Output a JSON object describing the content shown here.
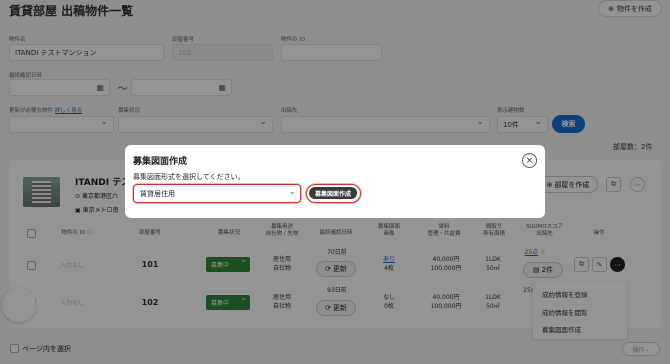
{
  "page": {
    "title": "賃貸部屋 出稿物件一覧",
    "add_button": "物件を作成"
  },
  "filters": {
    "property_name_label": "物件名",
    "property_name_value": "ITANDI テストマンション",
    "room_number_label": "部屋番号",
    "room_number_value": "102",
    "property_id_label": "物件の ID",
    "last_checked_label": "最終確認日時",
    "date_separator": "〜",
    "update_needed_label": "更新が必要な物件",
    "details_link": "詳しく見る",
    "recruitment_status_label": "募集状況",
    "listing_destination_label": "出稿先",
    "display_count_label": "表示建物数",
    "display_count_value": "10件",
    "search_button": "検索",
    "room_count": "部屋数：2件"
  },
  "building": {
    "name": "ITANDI テスト",
    "address": "東京都港区六",
    "station": "東京メトロ南",
    "create_room_button": "部屋を作成"
  },
  "table": {
    "headers": {
      "property_id": "物件の ID",
      "room_number": "部屋番号",
      "recruitment_status": "募集状況",
      "usage_line1": "募集用途",
      "usage_line2": "自社物 / 先物",
      "last_checked": "最終確認日時",
      "floorplan_line1": "募集図面",
      "floorplan_line2": "画像",
      "rent_line1": "賃料",
      "rent_line2": "管理・共益費",
      "layout_line1": "間取り",
      "layout_line2": "専有面積",
      "suumo_line1": "SUUMOスコア",
      "suumo_line2": "出稿先",
      "actions": "操作"
    },
    "rows": [
      {
        "id_placeholder": "入力なし",
        "room": "101",
        "status": "募集中",
        "usage1": "居住用",
        "usage2": "自社物",
        "days_ago": "70日前",
        "refresh": "更新",
        "floorplan1": "あり",
        "floorplan2": "4枚",
        "rent": "40,000円",
        "fee": "100,000円",
        "layout": "1LDK",
        "area": "50㎡",
        "score": "25点",
        "score_warn": "⚠",
        "media_count": "2件"
      },
      {
        "id_placeholder": "入力なし",
        "room": "102",
        "status": "募集中",
        "usage1": "居住用",
        "usage2": "自社物",
        "days_ago": "93日前",
        "refresh": "更新",
        "floorplan1": "なし",
        "floorplan2": "0枚",
        "rent": "40,000円",
        "fee": "100,000円",
        "layout": "1LDK",
        "area": "50㎡",
        "score": "25点"
      }
    ]
  },
  "context_menu": {
    "items": [
      "成約情報を登録",
      "成約情報を閲覧",
      "募集図面作成"
    ]
  },
  "footer": {
    "select_page": "ページ内を選択",
    "operation": "操作"
  },
  "modal": {
    "title": "募集図面作成",
    "instruction": "募集図面形式を選択してください。",
    "select_value": "賃貸居住用",
    "create_button": "募集図面作成",
    "close": "×"
  },
  "colors": {
    "primary": "#1d6fd4",
    "status_green": "#2e8b3a",
    "highlight_red": "#d32f2f"
  }
}
